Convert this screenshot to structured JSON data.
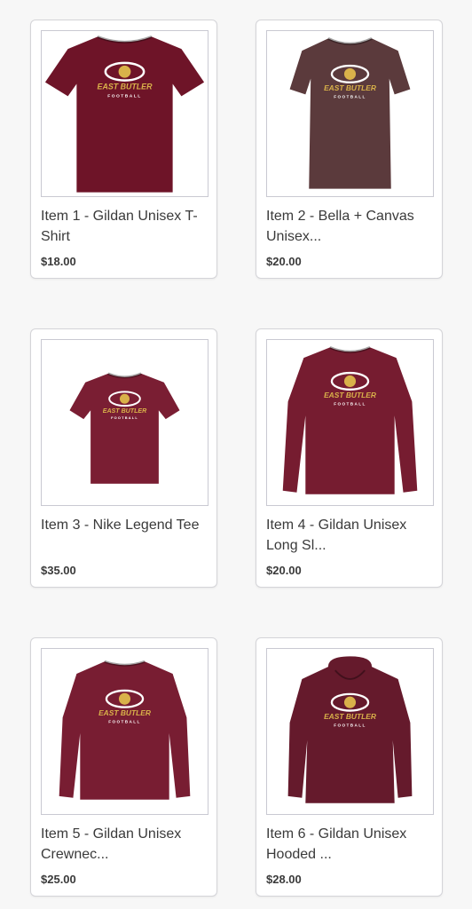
{
  "products": [
    {
      "title": "Item 1 - Gildan Unisex T-Shirt",
      "price": "$18.00",
      "garment": "tshirt",
      "color": "#6e1428",
      "logo_text": "EAST BUTLER",
      "logo_sub": "FOOTBALL"
    },
    {
      "title": "Item 2 - Bella + Canvas Unisex...",
      "price": "$20.00",
      "garment": "tshirt-fitted",
      "color": "#5b3a3c",
      "logo_text": "EAST BUTLER",
      "logo_sub": "FOOTBALL"
    },
    {
      "title": "Item 3 - Nike Legend Tee",
      "price": "$35.00",
      "garment": "tshirt-small",
      "color": "#7a1e33",
      "logo_text": "EAST BUTLER",
      "logo_sub": "FOOTBALL"
    },
    {
      "title": "Item 4 - Gildan Unisex Long Sl...",
      "price": "$20.00",
      "garment": "longsleeve",
      "color": "#761c30",
      "logo_text": "EAST BUTLER",
      "logo_sub": "FOOTBALL"
    },
    {
      "title": "Item 5 - Gildan Unisex Crewnec...",
      "price": "$25.00",
      "garment": "crewneck",
      "color": "#781d32",
      "logo_text": "EAST BUTLER",
      "logo_sub": "FOOTBALL"
    },
    {
      "title": "Item 6 - Gildan Unisex Hooded ...",
      "price": "$28.00",
      "garment": "hoodie",
      "color": "#651a2c",
      "logo_text": "EAST BUTLER",
      "logo_sub": "FOOTBALL"
    }
  ],
  "colors": {
    "logo_gold": "#d9b24a",
    "logo_white": "#ffffff"
  }
}
